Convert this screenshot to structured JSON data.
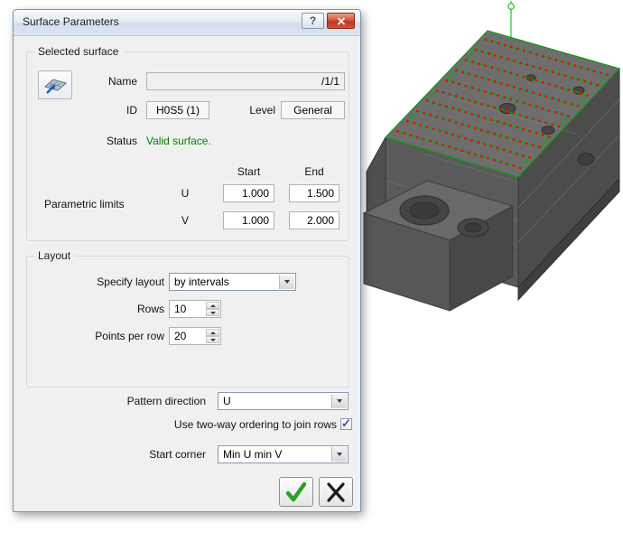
{
  "colors": {
    "status_green": "#008000",
    "grid_green": "#00b400",
    "point_red": "#dd1111"
  },
  "dialog": {
    "title": "Surface Parameters",
    "help_label": "?",
    "selected_surface": {
      "group_label": "Selected surface",
      "name_label": "Name",
      "name_value": "/1/1",
      "id_label": "ID",
      "id_value": "H0S5 (1)",
      "level_label": "Level",
      "level_value": "General",
      "status_label": "Status",
      "status_value": "Valid surface.",
      "limits_label": "Parametric limits",
      "start_header": "Start",
      "end_header": "End",
      "u_label": "U",
      "v_label": "V",
      "u_start": "1.000",
      "u_end": "1.500",
      "v_start": "1.000",
      "v_end": "2.000"
    },
    "layout_group": {
      "group_label": "Layout",
      "specify_label": "Specify layout",
      "specify_value": "by intervals",
      "rows_label": "Rows",
      "rows_value": "10",
      "points_label": "Points per row",
      "points_value": "20"
    },
    "pattern": {
      "direction_label": "Pattern direction",
      "direction_value": "U",
      "two_way_label": "Use two-way ordering to join rows",
      "two_way_checked": true,
      "start_corner_label": "Start corner",
      "start_corner_value": "Min U min V"
    }
  }
}
